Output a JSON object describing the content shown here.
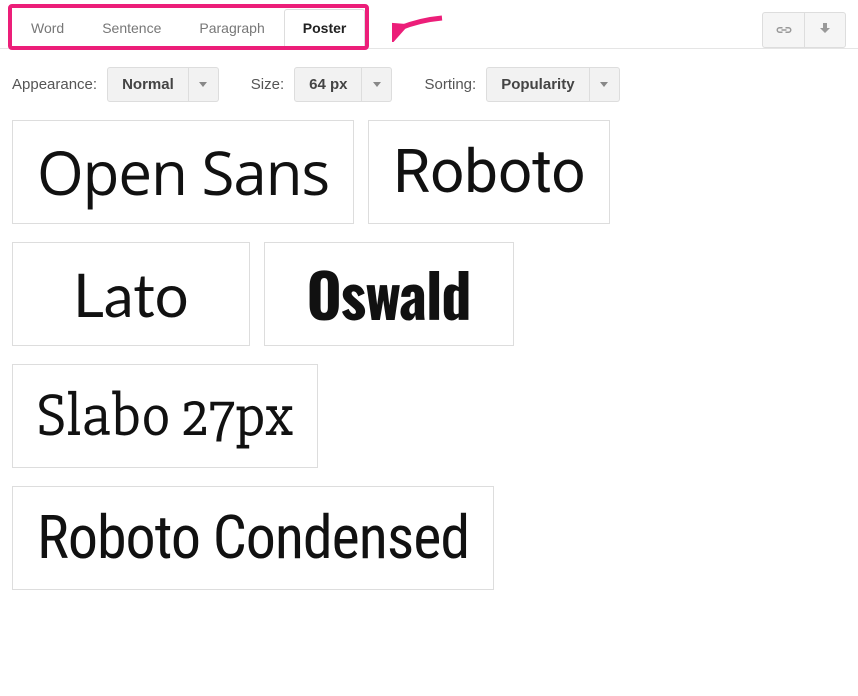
{
  "tabs": [
    {
      "label": "Word",
      "active": false
    },
    {
      "label": "Sentence",
      "active": false
    },
    {
      "label": "Paragraph",
      "active": false
    },
    {
      "label": "Poster",
      "active": true
    }
  ],
  "controls": {
    "appearance_label": "Appearance:",
    "appearance_value": "Normal",
    "size_label": "Size:",
    "size_value": "64 px",
    "sorting_label": "Sorting:",
    "sorting_value": "Popularity"
  },
  "fonts": {
    "row1": [
      {
        "name": "Open Sans"
      },
      {
        "name": "Roboto"
      }
    ],
    "row2": [
      {
        "name": "Lato"
      },
      {
        "name": "Oswald"
      }
    ],
    "row3": [
      {
        "name": "Slabo 27px"
      }
    ],
    "row4": [
      {
        "name": "Roboto Condensed"
      }
    ]
  },
  "highlight_color": "#ec1e79"
}
